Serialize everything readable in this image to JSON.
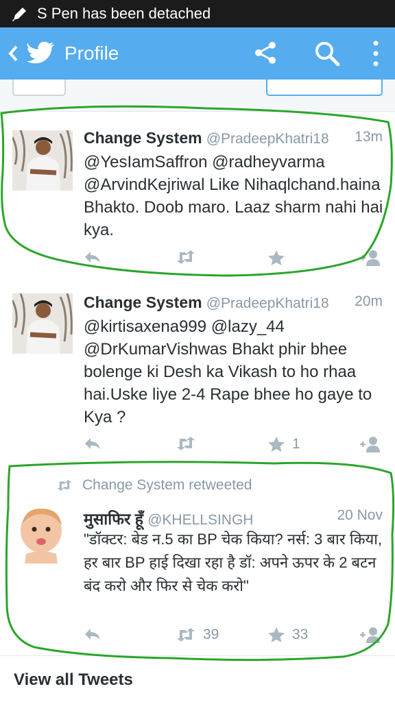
{
  "status_bar": {
    "text": "S Pen has been detached"
  },
  "app_bar": {
    "title": "Profile"
  },
  "tweets": [
    {
      "name": "Change System",
      "handle": "@PradeepKhatri18",
      "time": "13m",
      "text": "@YesIamSaffron @radheyvarma @ArvindKejriwal  Like Nihaqlchand.haina Bhakto. Doob maro. Laaz sharm nahi hai kya."
    },
    {
      "name": "Change System",
      "handle": "@PradeepKhatri18",
      "time": "20m",
      "text": "@kirtisaxena999 @lazy_44 @DrKumarVishwas Bhakt phir bhee bolenge ki Desh ka Vikash to ho rhaa hai.Uske liye 2-4 Rape bhee ho gaye to Kya ?",
      "favorites": "1"
    },
    {
      "retweeted_by": "Change System retweeted",
      "name": "मुसाफिर हूँ",
      "handle": "@KHELLSINGH",
      "time": "20 Nov",
      "text": "\"डॉक्टर: बेड न.5 का BP चेक किया? नर्स: 3 बार किया, हर बार BP हाई दिखा रहा है डॉ: अपने ऊपर के 2 बटन बंद करो और फिर से चेक करो\"",
      "retweets": "39",
      "favorites": "33"
    }
  ],
  "footer": {
    "view_all": "View all Tweets"
  },
  "colors": {
    "twitter_blue": "#55acee",
    "annotation_green": "#2aa52a"
  }
}
